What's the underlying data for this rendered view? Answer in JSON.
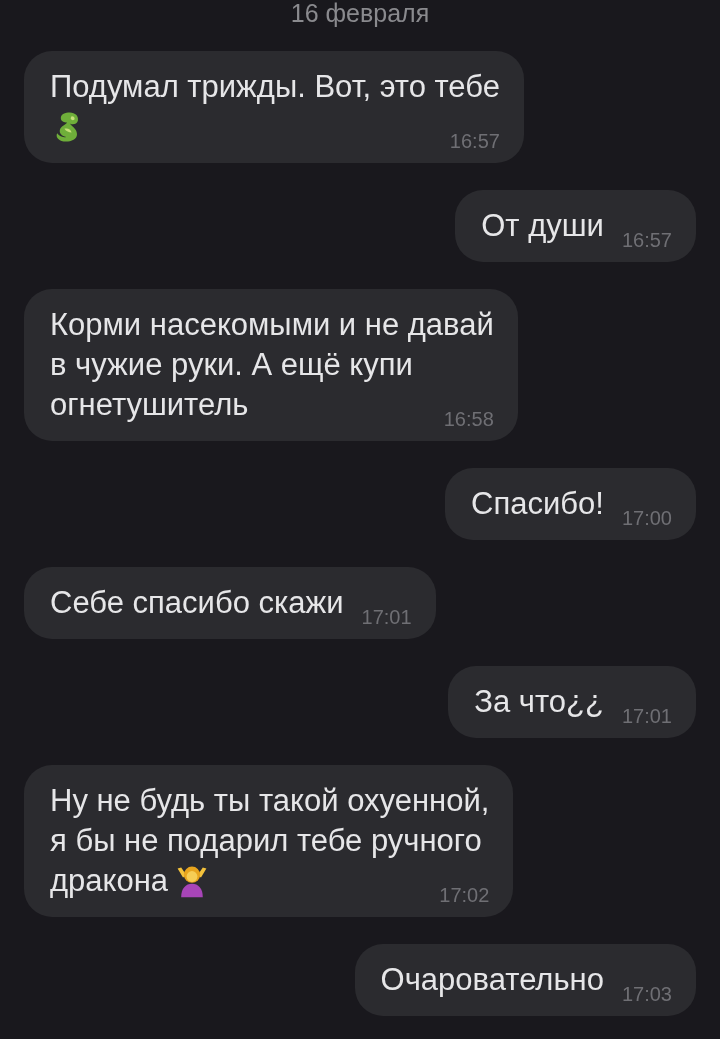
{
  "date_header": "16 февраля",
  "messages": [
    {
      "kind": "incoming",
      "lines": [
        "Подумал трижды. Вот, это тебе"
      ],
      "emoji": {
        "kind": "dragon"
      },
      "time": "16:57"
    },
    {
      "kind": "outgoing",
      "lines": [
        "От души"
      ],
      "time": "16:57"
    },
    {
      "kind": "incoming",
      "lines": [
        "Корми насекомыми и не давай",
        "в чужие руки. А ещё купи",
        "огнетушитель"
      ],
      "time": "16:58"
    },
    {
      "kind": "outgoing",
      "lines": [
        "Спасибо!"
      ],
      "time": "17:00"
    },
    {
      "kind": "incoming",
      "lines": [
        "Себе спасибо скажи"
      ],
      "time": "17:01"
    },
    {
      "kind": "outgoing",
      "lines": [
        "За что¿¿"
      ],
      "time": "17:01"
    },
    {
      "kind": "incoming",
      "lines": [
        "Ну не будь ты такой охуенной,",
        "я бы не подарил тебе ручного",
        "дракона"
      ],
      "emoji": {
        "kind": "shrug"
      },
      "time": "17:02"
    },
    {
      "kind": "outgoing",
      "lines": [
        "Очаровательно"
      ],
      "time": "17:03"
    }
  ]
}
